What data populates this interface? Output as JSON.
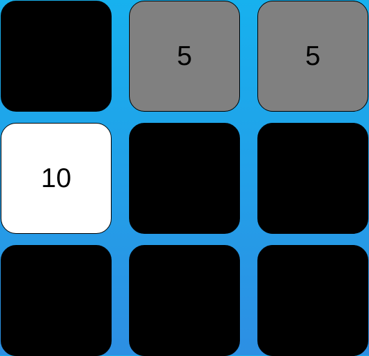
{
  "colors": {
    "background_top": "#17b1ee",
    "background_bottom": "#2d8fe3",
    "tile_black": "#000000",
    "tile_gray": "#808080",
    "tile_white": "#ffffff"
  },
  "board": {
    "rows": 3,
    "cols": 3,
    "tiles": [
      {
        "row": 0,
        "col": 0,
        "color": "black",
        "value": ""
      },
      {
        "row": 0,
        "col": 1,
        "color": "gray",
        "value": "5"
      },
      {
        "row": 0,
        "col": 2,
        "color": "gray",
        "value": "5"
      },
      {
        "row": 1,
        "col": 0,
        "color": "white",
        "value": "10"
      },
      {
        "row": 1,
        "col": 1,
        "color": "black",
        "value": ""
      },
      {
        "row": 1,
        "col": 2,
        "color": "black",
        "value": ""
      },
      {
        "row": 2,
        "col": 0,
        "color": "black",
        "value": ""
      },
      {
        "row": 2,
        "col": 1,
        "color": "black",
        "value": ""
      },
      {
        "row": 2,
        "col": 2,
        "color": "black",
        "value": ""
      }
    ]
  }
}
